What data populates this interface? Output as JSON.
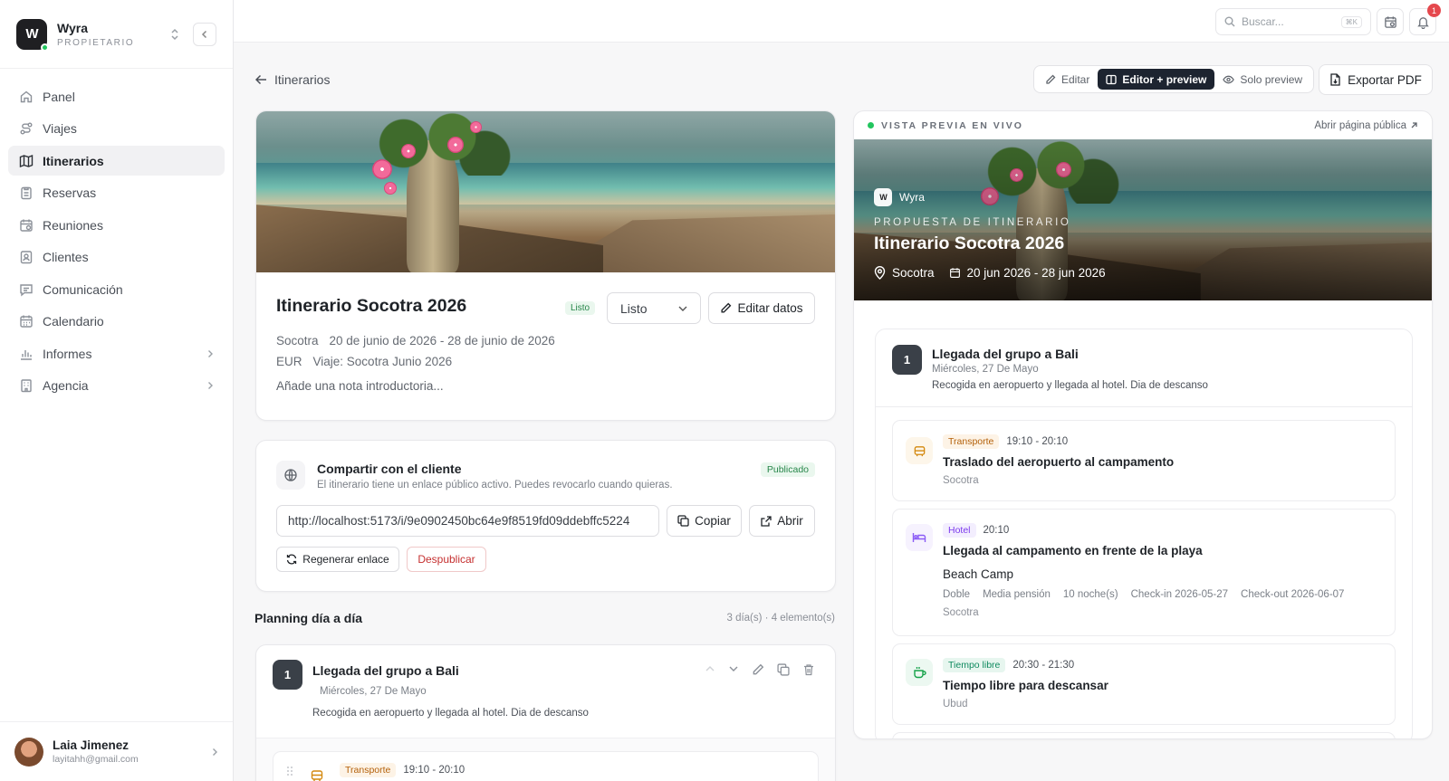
{
  "brand": {
    "logo_text": "W",
    "name": "Wyra",
    "role": "PROPIETARIO"
  },
  "nav": [
    {
      "label": "Panel",
      "icon": "home-icon"
    },
    {
      "label": "Viajes",
      "icon": "route-icon"
    },
    {
      "label": "Itinerarios",
      "icon": "map-icon",
      "active": true
    },
    {
      "label": "Reservas",
      "icon": "clipboard-icon"
    },
    {
      "label": "Reuniones",
      "icon": "calendar-clock-icon"
    },
    {
      "label": "Clientes",
      "icon": "contact-icon"
    },
    {
      "label": "Comunicación",
      "icon": "message-icon"
    },
    {
      "label": "Calendario",
      "icon": "calendar-icon"
    },
    {
      "label": "Informes",
      "icon": "chart-icon",
      "has_children": true
    },
    {
      "label": "Agencia",
      "icon": "building-icon",
      "has_children": true
    }
  ],
  "user": {
    "name": "Laia Jimenez",
    "email": "layitahh@gmail.com"
  },
  "topbar": {
    "search_placeholder": "Buscar...",
    "search_shortcut": "⌘K",
    "notifications_count": "1"
  },
  "header": {
    "back_label": "Itinerarios",
    "view_modes": {
      "edit": "Editar",
      "split": "Editor + preview",
      "preview": "Solo preview"
    },
    "export_label": "Exportar PDF"
  },
  "itinerary": {
    "title": "Itinerario Socotra 2026",
    "status_pill": "Listo",
    "status_select": "Listo",
    "edit_label": "Editar datos",
    "destination": "Socotra",
    "dates_long": "20 de junio de 2026 - 28 de junio de 2026",
    "currency": "EUR",
    "trip": "Viaje: Socotra Junio 2026",
    "note_placeholder": "Añade una nota introductoria..."
  },
  "share": {
    "title": "Compartir con el cliente",
    "description": "El itinerario tiene un enlace público activo. Puedes revocarlo cuando quieras.",
    "status": "Publicado",
    "link": "http://localhost:5173/i/9e0902450bc64e9f8519fd09ddebffc5224",
    "copy_label": "Copiar",
    "open_label": "Abrir",
    "regen_label": "Regenerar enlace",
    "unpublish_label": "Despublicar"
  },
  "planning": {
    "title": "Planning día a día",
    "count": "3 día(s) · 4 elemento(s)",
    "day": {
      "number": "1",
      "title": "Llegada del grupo a Bali",
      "date": "Miércoles, 27 De Mayo",
      "description": "Recogida en aeropuerto y llegada al hotel. Dia de descanso"
    },
    "first_event": {
      "tag": "Transporte",
      "time": "19:10 - 20:10"
    }
  },
  "preview": {
    "live_label": "VISTA PREVIA EN VIVO",
    "open_public": "Abrir página pública",
    "brand": "Wyra",
    "kicker": "PROPUESTA DE ITINERARIO",
    "title": "Itinerario Socotra 2026",
    "location": "Socotra",
    "dates": "20 jun 2026 - 28 jun 2026",
    "day": {
      "number": "1",
      "title": "Llegada del grupo a Bali",
      "date": "Miércoles, 27 De Mayo",
      "description": "Recogida en aeropuerto y llegada al hotel. Dia de descanso"
    },
    "events": [
      {
        "tag": "Transporte",
        "time": "19:10 - 20:10",
        "title": "Traslado del aeropuerto al campamento",
        "location": "Socotra"
      },
      {
        "tag": "Hotel",
        "time": "20:10",
        "title": "Llegada al campamento en frente de la playa",
        "hotel": "Beach Camp",
        "details": [
          "Doble",
          "Media pensión",
          "10 noche(s)",
          "Check-in 2026-05-27",
          "Check-out 2026-06-07"
        ],
        "location": "Socotra"
      },
      {
        "tag": "Tiempo libre",
        "time": "20:30 - 21:30",
        "title": "Tiempo libre para descansar",
        "location": "Ubud"
      }
    ]
  },
  "colors": {
    "accent_dark": "#1d2430",
    "live_green": "#22c55e",
    "notification_red": "#e5484d"
  }
}
